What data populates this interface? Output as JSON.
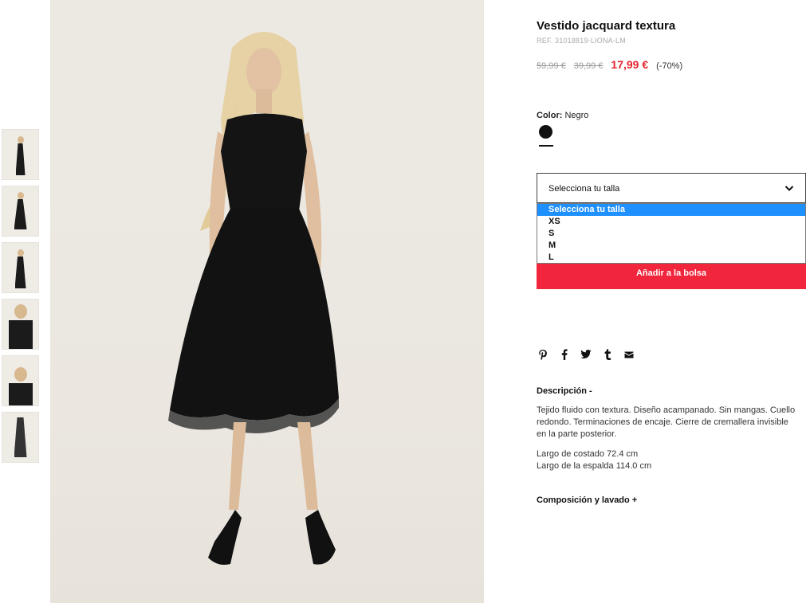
{
  "product": {
    "title": "Vestido jacquard textura",
    "ref": "REF. 31018819-LIONA-LM",
    "price_original_1": "59,99 €",
    "price_original_2": "39,99 €",
    "price_current": "17,99 €",
    "discount": "(-70%)"
  },
  "color": {
    "label": "Color:",
    "value": "Negro",
    "swatch_hex": "#111111"
  },
  "size_select": {
    "placeholder": "Selecciona tu talla",
    "options": [
      "Selecciona tu talla",
      "XS",
      "S",
      "M",
      "L"
    ],
    "selected_index": 0
  },
  "add_to_bag_label": "Añadir a la bolsa",
  "share_icons": [
    "pinterest-icon",
    "facebook-icon",
    "twitter-icon",
    "tumblr-icon",
    "email-icon"
  ],
  "description": {
    "title": "Descripción -",
    "text": "Tejido fluido con textura. Diseño acampanado. Sin mangas. Cuello redondo. Terminaciones de encaje. Cierre de cremallera invisible en la parte posterior.",
    "measure_1": "Largo de costado 72.4 cm",
    "measure_2": "Largo de la espalda 114.0 cm"
  },
  "composition_title": "Composición y lavado +",
  "colors": {
    "accent_red": "#e4242f",
    "button_red": "#f1263c",
    "dropdown_highlight": "#1e90ff"
  }
}
